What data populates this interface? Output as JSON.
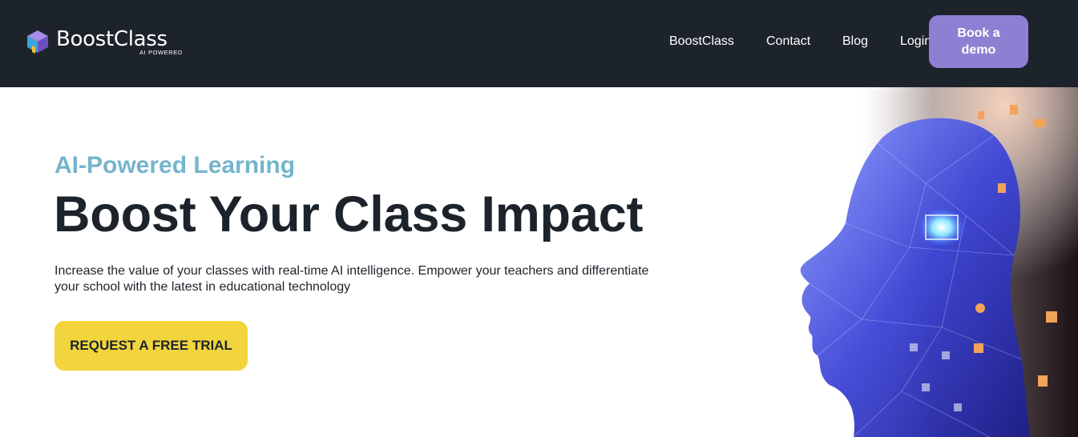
{
  "header": {
    "logo_name": "BoostClass",
    "logo_tagline": "AI POWERED",
    "nav": [
      {
        "label": "BoostClass"
      },
      {
        "label": "Contact"
      },
      {
        "label": "Blog"
      },
      {
        "label": "Login"
      }
    ],
    "demo_button_label": "Book a demo"
  },
  "hero": {
    "eyebrow": "AI-Powered Learning",
    "title": "Boost Your Class Impact",
    "description": "Increase the value of your classes with real-time AI intelligence. Empower your teachers and differentiate your school with the latest in educational technology",
    "cta_label": "REQUEST A FREE TRIAL",
    "image_icon": "ai-head-illustration"
  },
  "colors": {
    "navbar_bg": "#1d232b",
    "demo_button": "#8f7fd3",
    "eyebrow": "#75b4cc",
    "title": "#1d232b",
    "cta_button": "#f2d43d"
  }
}
